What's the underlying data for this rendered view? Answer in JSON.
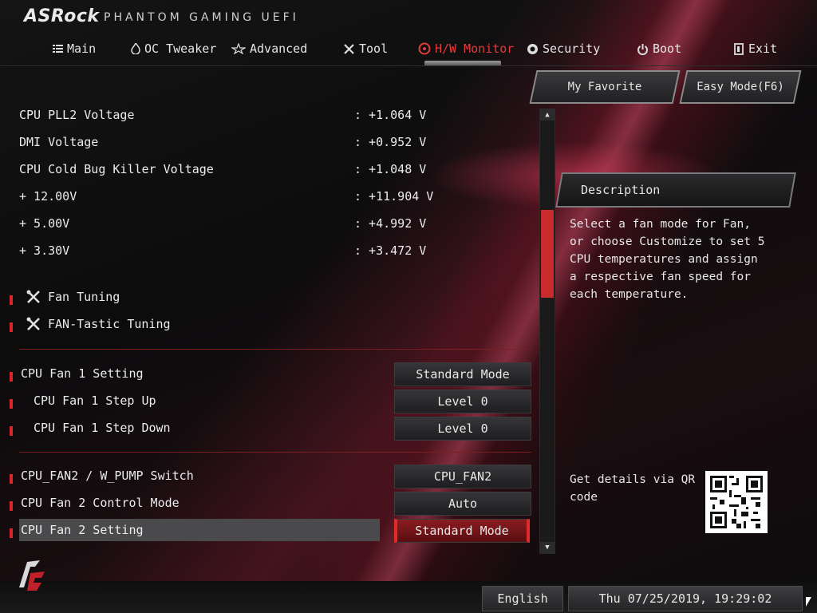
{
  "header": {
    "brand": "ASRock",
    "subtitle": "PHANTOM GAMING UEFI"
  },
  "nav": {
    "items": [
      {
        "label": "Main",
        "icon": "list-icon"
      },
      {
        "label": "OC Tweaker",
        "icon": "flame-icon"
      },
      {
        "label": "Advanced",
        "icon": "star-icon"
      },
      {
        "label": "Tool",
        "icon": "tools-icon"
      },
      {
        "label": "H/W Monitor",
        "icon": "monitor-icon",
        "active": true
      },
      {
        "label": "Security",
        "icon": "shield-icon"
      },
      {
        "label": "Boot",
        "icon": "power-icon"
      },
      {
        "label": "Exit",
        "icon": "exit-icon"
      }
    ]
  },
  "toolbar": {
    "favorite_label": "My Favorite",
    "easy_mode_label": "Easy Mode(F6)"
  },
  "readings": [
    {
      "label": "CPU PLL2 Voltage",
      "value": ": +1.064 V"
    },
    {
      "label": "DMI Voltage",
      "value": ": +0.952 V"
    },
    {
      "label": "CPU Cold Bug Killer Voltage",
      "value": ": +1.048 V"
    },
    {
      "label": "+ 12.00V",
      "value": ": +11.904 V"
    },
    {
      "label": "+ 5.00V",
      "value": ": +4.992 V"
    },
    {
      "label": "+ 3.30V",
      "value": ": +3.472 V"
    }
  ],
  "tools": [
    {
      "label": "Fan Tuning"
    },
    {
      "label": "FAN-Tastic Tuning"
    }
  ],
  "settings": [
    {
      "label": "CPU Fan 1 Setting",
      "value": "Standard Mode"
    },
    {
      "label": "CPU Fan 1 Step Up",
      "value": "Level 0"
    },
    {
      "label": "CPU Fan 1 Step Down",
      "value": "Level 0"
    },
    {
      "label": "CPU_FAN2 / W_PUMP Switch",
      "value": "CPU_FAN2"
    },
    {
      "label": "CPU Fan 2 Control Mode",
      "value": "Auto"
    },
    {
      "label": "CPU Fan 2 Setting",
      "value": "Standard Mode"
    }
  ],
  "description": {
    "title": "Description",
    "text": "Select a fan mode for Fan, or choose Customize to set 5 CPU temperatures and assign a respective fan speed for each temperature.",
    "qr_text": "Get details via QR code"
  },
  "footer": {
    "language": "English",
    "datetime": "Thu 07/25/2019, 19:29:02"
  },
  "colors": {
    "accent": "#e23b3b",
    "marker": "#d8262a"
  }
}
